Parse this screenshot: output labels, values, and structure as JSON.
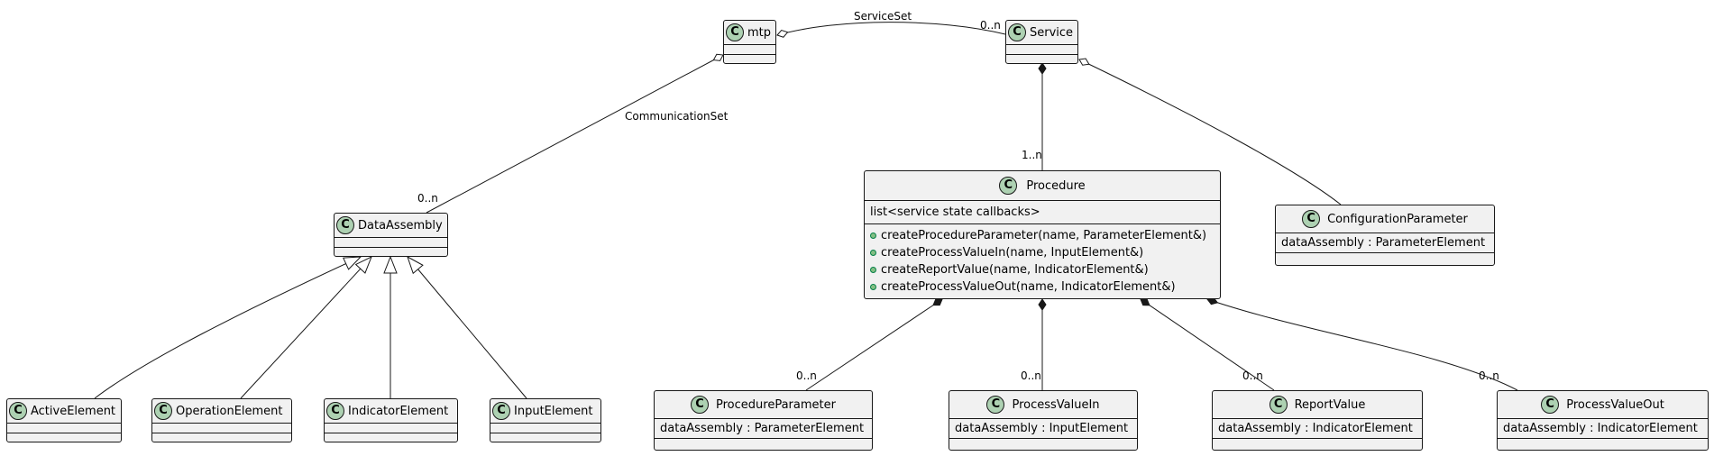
{
  "classes": {
    "mtp": {
      "name": "mtp",
      "stereotype_icon": "C",
      "fields": [],
      "methods": []
    },
    "service": {
      "name": "Service",
      "stereotype_icon": "C",
      "fields": [],
      "methods": []
    },
    "data_assembly": {
      "name": "DataAssembly",
      "stereotype_icon": "C",
      "fields": [],
      "methods": []
    },
    "procedure": {
      "name": "Procedure",
      "stereotype_icon": "C",
      "fields": [
        "list<service state callbacks>"
      ],
      "methods": [
        "createProcedureParameter(name, ParameterElement&)",
        "createProcessValueIn(name, InputElement&)",
        "createReportValue(name, IndicatorElement&)",
        "createProcessValueOut(name, IndicatorElement&)"
      ]
    },
    "configuration_parameter": {
      "name": "ConfigurationParameter",
      "stereotype_icon": "C",
      "fields": [
        "dataAssembly : ParameterElement"
      ],
      "methods": []
    },
    "active_element": {
      "name": "ActiveElement",
      "stereotype_icon": "C",
      "fields": [],
      "methods": []
    },
    "operation_element": {
      "name": "OperationElement",
      "stereotype_icon": "C",
      "fields": [],
      "methods": []
    },
    "indicator_element": {
      "name": "IndicatorElement",
      "stereotype_icon": "C",
      "fields": [],
      "methods": []
    },
    "input_element": {
      "name": "InputElement",
      "stereotype_icon": "C",
      "fields": [],
      "methods": []
    },
    "procedure_parameter": {
      "name": "ProcedureParameter",
      "stereotype_icon": "C",
      "fields": [
        "dataAssembly : ParameterElement"
      ],
      "methods": []
    },
    "process_value_in": {
      "name": "ProcessValueIn",
      "stereotype_icon": "C",
      "fields": [
        "dataAssembly : InputElement"
      ],
      "methods": []
    },
    "report_value": {
      "name": "ReportValue",
      "stereotype_icon": "C",
      "fields": [
        "dataAssembly : IndicatorElement"
      ],
      "methods": []
    },
    "process_value_out": {
      "name": "ProcessValueOut",
      "stereotype_icon": "C",
      "fields": [
        "dataAssembly : IndicatorElement"
      ],
      "methods": []
    }
  },
  "relations": {
    "service_set": {
      "from": "mtp",
      "to": "Service",
      "type": "aggregation",
      "label": "ServiceSet",
      "multiplicity": "0..n"
    },
    "communication_set": {
      "from": "mtp",
      "to": "DataAssembly",
      "type": "aggregation",
      "label": "CommunicationSet",
      "multiplicity": "0..n"
    },
    "service_procedure": {
      "from": "Service",
      "to": "Procedure",
      "type": "composition",
      "multiplicity": "1..n"
    },
    "service_config": {
      "from": "Service",
      "to": "ConfigurationParameter",
      "type": "aggregation"
    },
    "proc_param": {
      "from": "Procedure",
      "to": "ProcedureParameter",
      "type": "composition",
      "multiplicity": "0..n"
    },
    "proc_pvin": {
      "from": "Procedure",
      "to": "ProcessValueIn",
      "type": "composition",
      "multiplicity": "0..n"
    },
    "proc_report": {
      "from": "Procedure",
      "to": "ReportValue",
      "type": "composition",
      "multiplicity": "0..n"
    },
    "proc_pvout": {
      "from": "Procedure",
      "to": "ProcessValueOut",
      "type": "composition",
      "multiplicity": "0..n"
    },
    "inherit": [
      {
        "from": "ActiveElement",
        "to": "DataAssembly",
        "type": "generalization"
      },
      {
        "from": "OperationElement",
        "to": "DataAssembly",
        "type": "generalization"
      },
      {
        "from": "IndicatorElement",
        "to": "DataAssembly",
        "type": "generalization"
      },
      {
        "from": "InputElement",
        "to": "DataAssembly",
        "type": "generalization"
      }
    ]
  },
  "colors": {
    "class_bg": "#f1f1f1",
    "class_border": "#181818",
    "circle_bg": "#add1b2",
    "method_dot": "#84be84"
  }
}
